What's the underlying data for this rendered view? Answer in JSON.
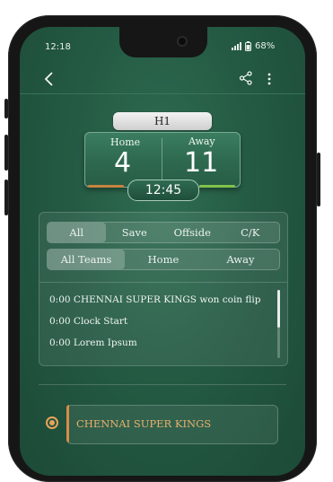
{
  "status_bar": {
    "time": "12:18",
    "battery": "68%"
  },
  "header": {
    "back_icon": "back-arrow-icon",
    "share_icon": "share-icon",
    "more_icon": "more-vertical-icon"
  },
  "scoreboard": {
    "period": "H1",
    "home_label": "Home",
    "away_label": "Away",
    "home_score": "4",
    "away_score": "11",
    "clock": "12:45",
    "home_color": "#c6833f",
    "away_color": "#7fc24b"
  },
  "filters": {
    "event_types": [
      "All",
      "Save",
      "Offside",
      "C/K"
    ],
    "teams": [
      "All Teams",
      "Home",
      "Away"
    ]
  },
  "events": [
    "0:00 CHENNAI SUPER KINGS won coin flip",
    "0:00 Clock Start",
    "0:00 Lorem Ipsum"
  ],
  "team_selector": {
    "team_name": "CHENNAI SUPER KINGS",
    "accent": "#e8a35a"
  }
}
